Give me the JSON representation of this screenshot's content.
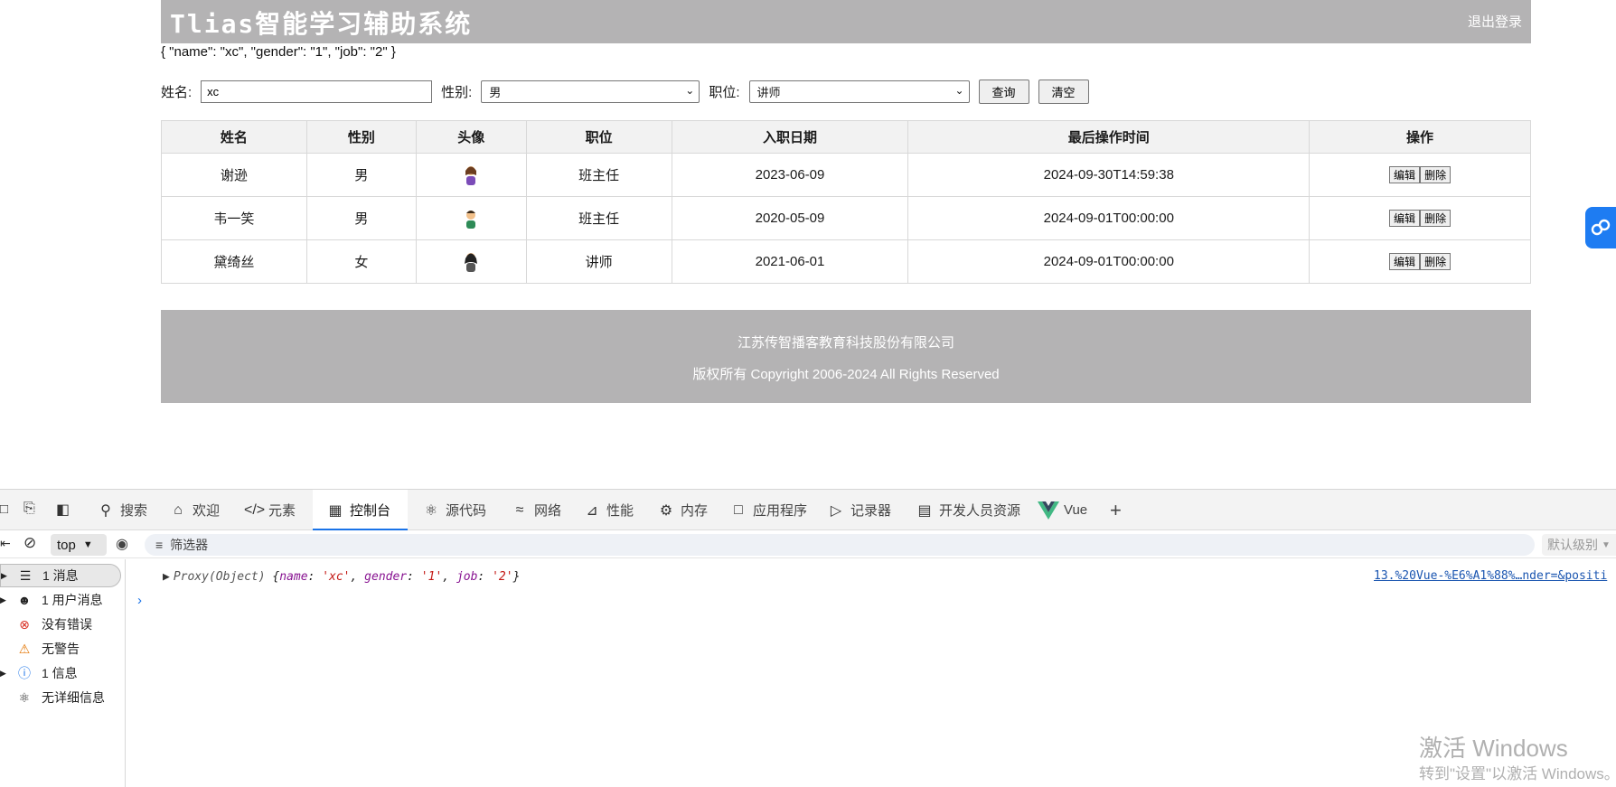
{
  "app": {
    "title": "Tlias智能学习辅助系统",
    "logout": "退出登录",
    "json_dump": "{ \"name\": \"xc\", \"gender\": \"1\", \"job\": \"2\" }",
    "search": {
      "name_label": "姓名:",
      "name_value": "xc",
      "gender_label": "性别:",
      "gender_value": "男",
      "job_label": "职位:",
      "job_value": "讲师",
      "query_btn": "查询",
      "clear_btn": "清空"
    },
    "table": {
      "headers": [
        "姓名",
        "性别",
        "头像",
        "职位",
        "入职日期",
        "最后操作时间",
        "操作"
      ],
      "rows": [
        {
          "name": "谢逊",
          "gender": "男",
          "job": "班主任",
          "entry": "2023-06-09",
          "updated": "2024-09-30T14:59:38"
        },
        {
          "name": "韦一笑",
          "gender": "男",
          "job": "班主任",
          "entry": "2020-05-09",
          "updated": "2024-09-01T00:00:00"
        },
        {
          "name": "黛绮丝",
          "gender": "女",
          "job": "讲师",
          "entry": "2021-06-01",
          "updated": "2024-09-01T00:00:00"
        }
      ],
      "edit": "编辑",
      "delete": "删除"
    },
    "footer": {
      "company": "江苏传智播客教育科技股份有限公司",
      "copyright": "版权所有 Copyright 2006-2024 All Rights Reserved"
    }
  },
  "devtools": {
    "tabs": [
      {
        "label": "搜索",
        "icon": "search-icon"
      },
      {
        "label": "欢迎",
        "icon": "home-icon"
      },
      {
        "label": "元素",
        "icon": "code-icon"
      },
      {
        "label": "控制台",
        "icon": "console-icon",
        "active": true
      },
      {
        "label": "源代码",
        "icon": "bug-icon"
      },
      {
        "label": "网络",
        "icon": "wifi-icon"
      },
      {
        "label": "性能",
        "icon": "gauge-icon"
      },
      {
        "label": "内存",
        "icon": "chip-icon"
      },
      {
        "label": "应用程序",
        "icon": "window-icon"
      },
      {
        "label": "记录器",
        "icon": "video-icon"
      },
      {
        "label": "开发人员资源",
        "icon": "book-icon"
      },
      {
        "label": "Vue",
        "icon": "vue-icon"
      }
    ],
    "context": "top",
    "filter_placeholder": "筛选器",
    "level": "默认级别",
    "sidebar": [
      {
        "label": "1 消息",
        "icon": "list-icon"
      },
      {
        "label": "1 用户消息",
        "icon": "user-icon"
      },
      {
        "label": "没有错误",
        "icon": "error-icon"
      },
      {
        "label": "无警告",
        "icon": "warning-icon"
      },
      {
        "label": "1 信息",
        "icon": "info-icon"
      },
      {
        "label": "无详细信息",
        "icon": "bug-icon"
      }
    ],
    "log": {
      "prefix": "Proxy(Object)",
      "k1": "name",
      "v1": "'xc'",
      "k2": "gender",
      "v2": "'1'",
      "k3": "job",
      "v3": "'2'",
      "source": "13.%20Vue-%E6%A1%88%…nder=&positi"
    },
    "colors": {
      "accent": "#1a73e8",
      "header_bg": "#b4b3b4"
    }
  },
  "watermark": {
    "line1": "激活 Windows",
    "line2": "转到\"设置\"以激活 Windows。"
  }
}
